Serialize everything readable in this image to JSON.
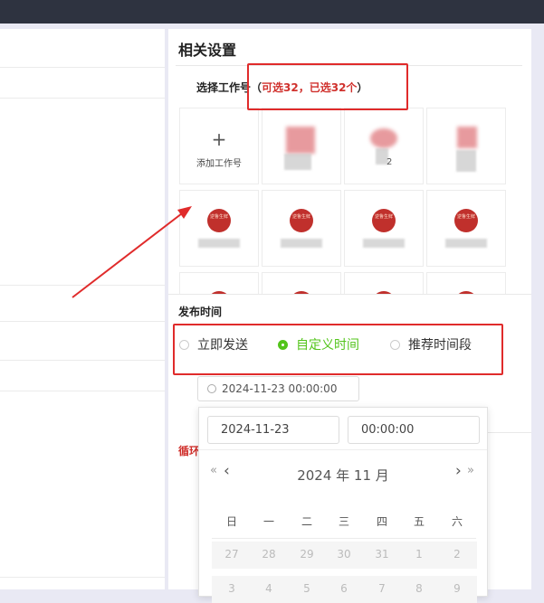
{
  "panel": {
    "title": "相关设置",
    "select_prefix": "选择工作号（",
    "select_highlight": "可选32，已选32个",
    "select_suffix": "）"
  },
  "tiles": {
    "add_label": "添加工作号",
    "add_symbol": "+",
    "partial_name": "2",
    "seal_text": "逆鲁生鲜"
  },
  "publish": {
    "title": "发布时间",
    "options": [
      "立即发送",
      "自定义时间",
      "推荐时间段"
    ],
    "selected": "自定义时间",
    "datetime_value": "2024-11-23 00:00:00"
  },
  "loop": {
    "label": "循环"
  },
  "picker": {
    "date_value": "2024-11-23",
    "time_value": "00:00:00",
    "month_label": "2024 年  11 月",
    "prev_year": "«",
    "prev_month": "‹",
    "next_month": "›",
    "next_year": "»",
    "weekdays": [
      "日",
      "一",
      "二",
      "三",
      "四",
      "五",
      "六"
    ],
    "row1": [
      "27",
      "28",
      "29",
      "30",
      "31",
      "1",
      "2"
    ],
    "row2": [
      "3",
      "4",
      "5",
      "6",
      "7",
      "8",
      "9"
    ]
  },
  "colors": {
    "accent_green": "#52c41a",
    "annotation_red": "#e02b2b",
    "highlight_red": "#d0312d"
  }
}
